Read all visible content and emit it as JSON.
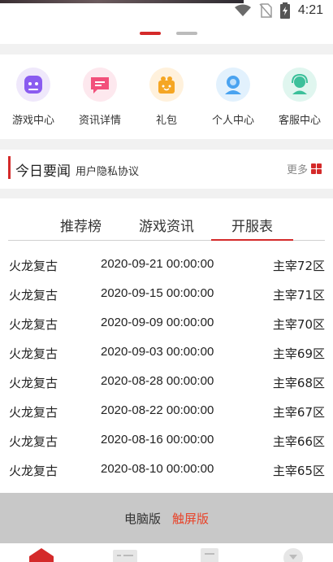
{
  "status_bar": {
    "time": "4:21",
    "icons": [
      "wifi-icon",
      "no-sim-icon",
      "battery-charging-icon"
    ]
  },
  "carousel": {
    "active_index": 0,
    "count": 2,
    "active_color": "#d42a2a",
    "inactive_color": "#bbbbbb"
  },
  "nav": {
    "items": [
      {
        "label": "游戏中心",
        "icon": "game-controller-icon",
        "color": "#7b4fe0"
      },
      {
        "label": "资讯详情",
        "icon": "message-icon",
        "color": "#f2507b"
      },
      {
        "label": "礼包",
        "icon": "gift-icon",
        "color": "#f5a623"
      },
      {
        "label": "个人中心",
        "icon": "user-icon",
        "color": "#4aa3f0"
      },
      {
        "label": "客服中心",
        "icon": "support-icon",
        "color": "#3cc09a"
      }
    ]
  },
  "news": {
    "title": "今日要闻",
    "subtitle": "用户隐私协议",
    "more_label": "更多"
  },
  "tabs": {
    "items": [
      "推荐榜",
      "游戏资讯",
      "开服表"
    ],
    "active_index": 2
  },
  "servers": [
    {
      "game": "火龙复古",
      "time": "2020-09-21 00:00:00",
      "server": "主宰72区"
    },
    {
      "game": "火龙复古",
      "time": "2020-09-15 00:00:00",
      "server": "主宰71区"
    },
    {
      "game": "火龙复古",
      "time": "2020-09-09 00:00:00",
      "server": "主宰70区"
    },
    {
      "game": "火龙复古",
      "time": "2020-09-03 00:00:00",
      "server": "主宰69区"
    },
    {
      "game": "火龙复古",
      "time": "2020-08-28 00:00:00",
      "server": "主宰68区"
    },
    {
      "game": "火龙复古",
      "time": "2020-08-22 00:00:00",
      "server": "主宰67区"
    },
    {
      "game": "火龙复古",
      "time": "2020-08-16 00:00:00",
      "server": "主宰66区"
    },
    {
      "game": "火龙复古",
      "time": "2020-08-10 00:00:00",
      "server": "主宰65区"
    }
  ],
  "footer": {
    "pc_label": "电脑版",
    "touch_label": "触屏版"
  },
  "bottom_nav": {
    "icons": [
      "home-icon",
      "list-icon",
      "document-icon",
      "profile-icon"
    ],
    "active_index": 0
  },
  "colors": {
    "accent": "#d42a2a",
    "touch_accent": "#e8442a"
  }
}
